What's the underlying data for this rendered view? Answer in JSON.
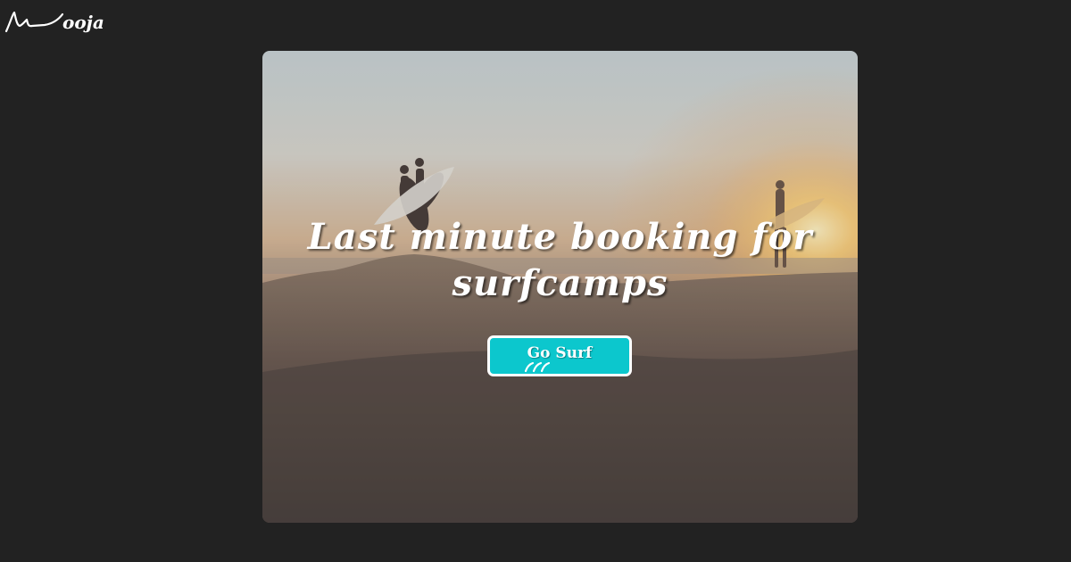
{
  "logo": {
    "text": "ooja",
    "icon": "wave-logo-icon"
  },
  "hero": {
    "headline": "Last minute booking for surfcamps",
    "cta_label": "Go Surf",
    "cta_icon": "wave-icon",
    "colors": {
      "page_background": "#222222",
      "cta_background": "#0cc7cd",
      "cta_border": "#ffffff",
      "text": "#ffffff"
    }
  }
}
